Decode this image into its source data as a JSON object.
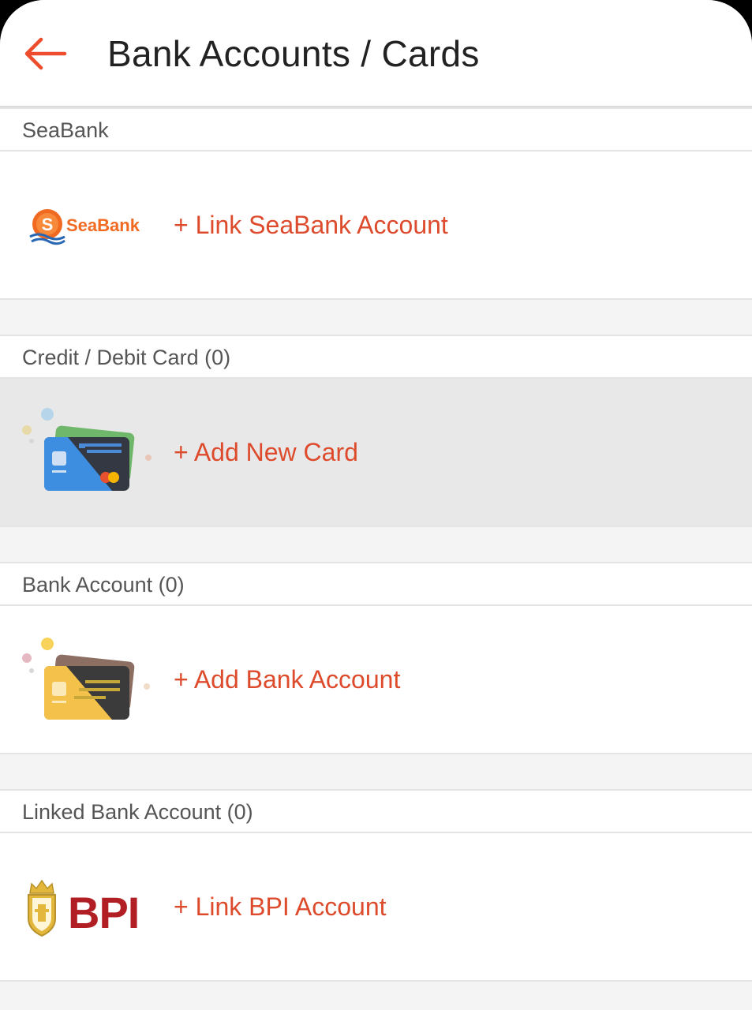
{
  "header": {
    "title": "Bank Accounts / Cards",
    "back_icon": "arrow-left-icon",
    "accent": "#ee4d2d"
  },
  "sections": {
    "seabank": {
      "title": "SeaBank",
      "logo_text": "SeaBank",
      "logo_coin": "S",
      "action": "+ Link SeaBank Account"
    },
    "card": {
      "title": "Credit / Debit Card (0)",
      "action": "+ Add New Card"
    },
    "bank": {
      "title": "Bank Account (0)",
      "action": "+ Add Bank Account"
    },
    "linked": {
      "title": "Linked Bank Account (0)",
      "logo_text": "BPI",
      "action": "+ Link BPI Account"
    }
  },
  "colors": {
    "action_text": "#dd4b2c",
    "seabank_orange": "#f26a21",
    "bpi_red": "#b11f24",
    "bpi_gold": "#e3b73b"
  }
}
